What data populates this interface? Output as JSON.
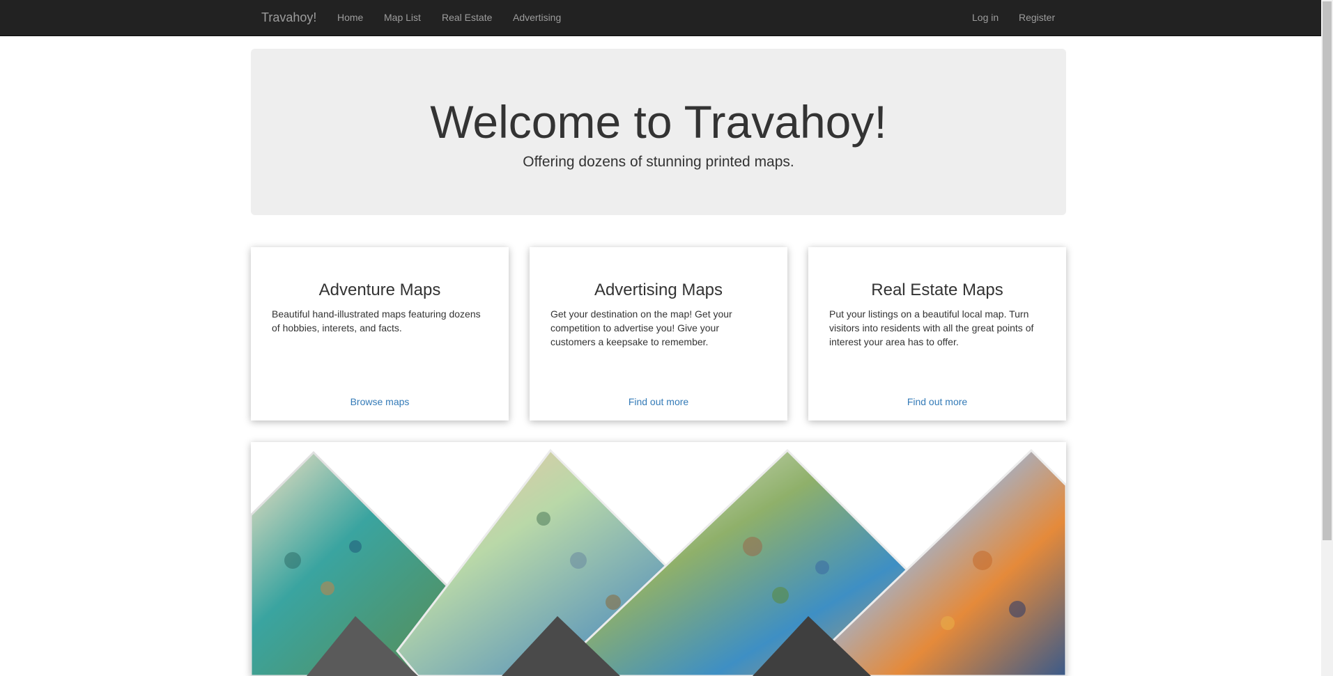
{
  "navbar": {
    "brand": "Travahoy!",
    "links": [
      {
        "label": "Home"
      },
      {
        "label": "Map List"
      },
      {
        "label": "Real Estate"
      },
      {
        "label": "Advertising"
      }
    ],
    "right_links": [
      {
        "label": "Log in"
      },
      {
        "label": "Register"
      }
    ]
  },
  "jumbotron": {
    "title": "Welcome to Travahoy!",
    "subtitle": "Offering dozens of stunning printed maps."
  },
  "cards": [
    {
      "title": "Adventure Maps",
      "text": "Beautiful hand-illustrated maps featuring dozens of hobbies, interets, and facts.",
      "link": "Browse maps"
    },
    {
      "title": "Advertising Maps",
      "text": "Get your destination on the map! Get your competition to advertise you! Give your customers a keepsake to remember.",
      "link": "Find out more"
    },
    {
      "title": "Real Estate Maps",
      "text": "Put your listings on a beautiful local map. Turn visitors into residents with all the great points of interest your area has to offer.",
      "link": "Find out more"
    }
  ],
  "colors": {
    "navbar_bg": "#222222",
    "nav_text": "#9d9d9d",
    "jumbotron_bg": "#eeeeee",
    "link": "#337ab7"
  }
}
